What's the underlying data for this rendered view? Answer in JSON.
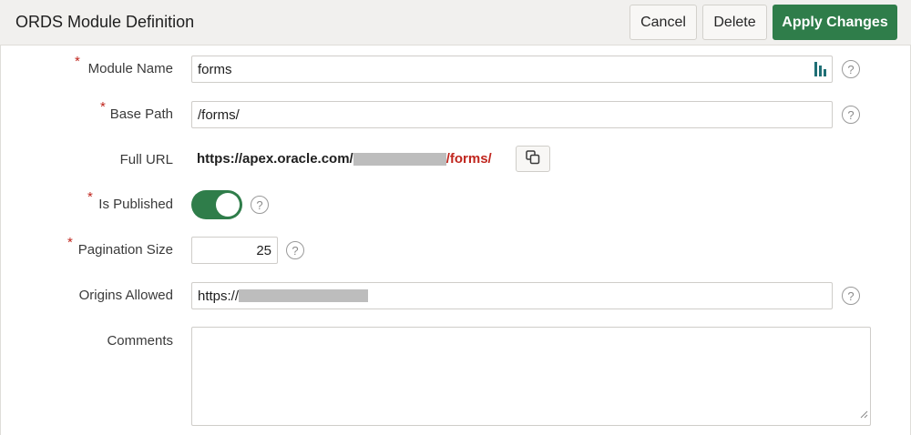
{
  "header": {
    "title": "ORDS Module Definition",
    "cancel_label": "Cancel",
    "delete_label": "Delete",
    "apply_label": "Apply Changes"
  },
  "form": {
    "required_marker": "*",
    "help_glyph": "?",
    "module_name": {
      "label": "Module Name",
      "value": "forms",
      "icon": "lookup-icon"
    },
    "base_path": {
      "label": "Base Path",
      "value": "/forms/"
    },
    "full_url": {
      "label": "Full URL",
      "prefix": "https://apex.oracle.com/",
      "suffix": "/forms/",
      "copy_icon": "copy-icon"
    },
    "is_published": {
      "label": "Is Published",
      "state": "on"
    },
    "pagination_size": {
      "label": "Pagination Size",
      "value": "25"
    },
    "origins_allowed": {
      "label": "Origins Allowed",
      "value": "https://"
    },
    "comments": {
      "label": "Comments",
      "value": ""
    }
  },
  "colors": {
    "accent": "#2f7d4a",
    "required": "#c0261e",
    "url_suffix": "#c0261e"
  }
}
